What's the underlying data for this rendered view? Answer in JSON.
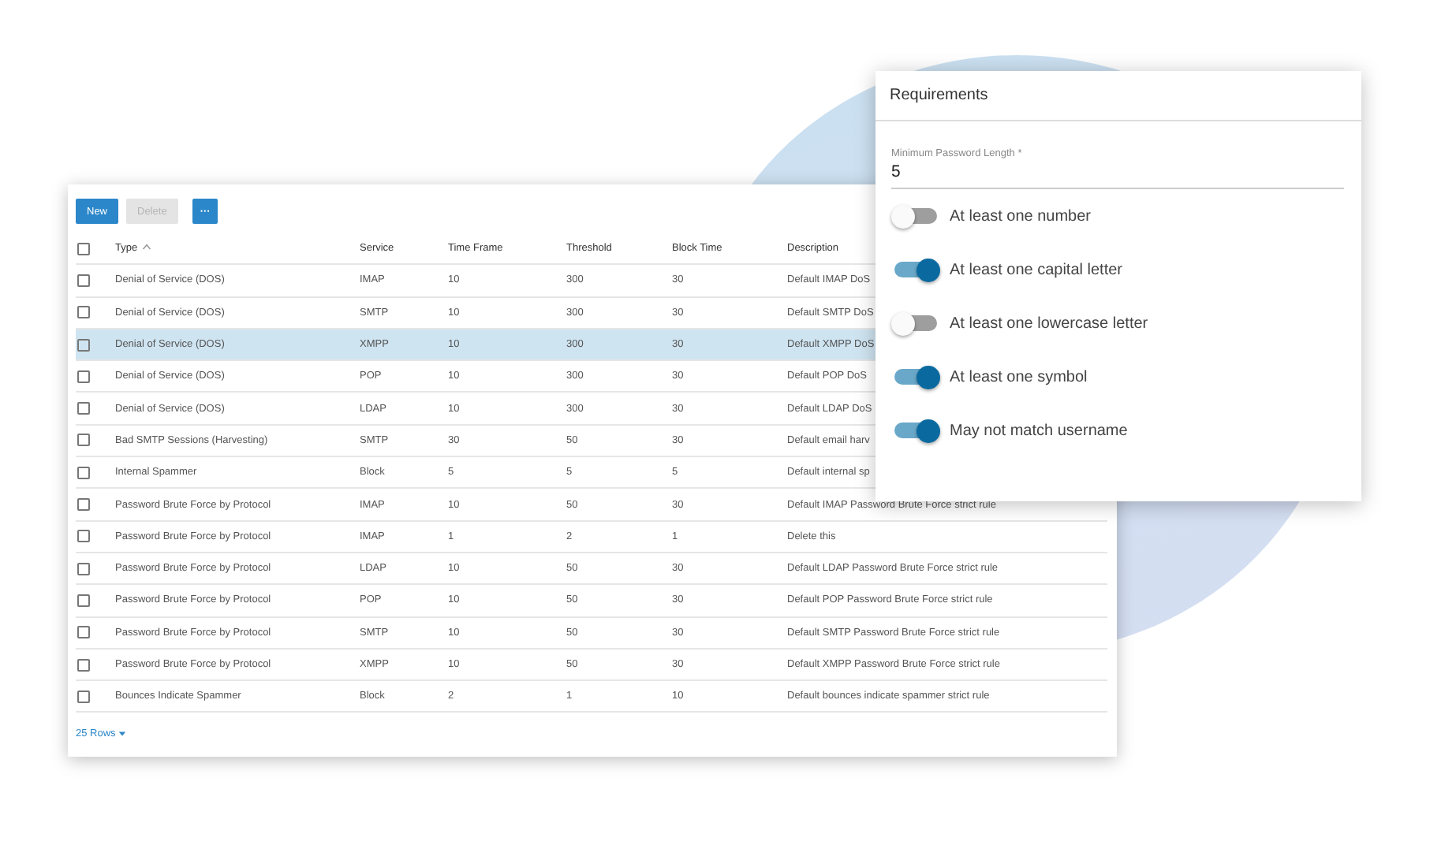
{
  "toolbar": {
    "buttons": [
      {
        "label": "New",
        "kind": "primary",
        "disabled": false
      },
      {
        "label": "Delete",
        "kind": "primary",
        "disabled": true
      },
      {
        "label": "···",
        "kind": "more",
        "disabled": false
      }
    ]
  },
  "table": {
    "select_all": {
      "checked": false
    },
    "columns": [
      {
        "label": "Type",
        "sorted": true
      },
      {
        "label": "Service",
        "sorted": false
      },
      {
        "label": "Time Frame",
        "sorted": false
      },
      {
        "label": "Threshold",
        "sorted": false
      },
      {
        "label": "Block Time",
        "sorted": false
      },
      {
        "label": "Description",
        "sorted": false
      }
    ],
    "rows": [
      {
        "cells": [
          "Denial of Service (DOS)",
          "IMAP",
          "10",
          "300",
          "30",
          "Default IMAP DoS"
        ],
        "checked": false,
        "selected": false
      },
      {
        "cells": [
          "Denial of Service (DOS)",
          "SMTP",
          "10",
          "300",
          "30",
          "Default SMTP DoS"
        ],
        "checked": false,
        "selected": false
      },
      {
        "cells": [
          "Denial of Service (DOS)",
          "XMPP",
          "10",
          "300",
          "30",
          "Default XMPP DoS"
        ],
        "checked": false,
        "selected": true
      },
      {
        "cells": [
          "Denial of Service (DOS)",
          "POP",
          "10",
          "300",
          "30",
          "Default POP DoS"
        ],
        "checked": false,
        "selected": false
      },
      {
        "cells": [
          "Denial of Service (DOS)",
          "LDAP",
          "10",
          "300",
          "30",
          "Default LDAP DoS"
        ],
        "checked": false,
        "selected": false
      },
      {
        "cells": [
          "Bad SMTP Sessions (Harvesting)",
          "SMTP",
          "30",
          "50",
          "30",
          "Default email harv"
        ],
        "checked": false,
        "selected": false
      },
      {
        "cells": [
          "Internal Spammer",
          "Block",
          "5",
          "5",
          "5",
          "Default internal sp"
        ],
        "checked": false,
        "selected": false
      },
      {
        "cells": [
          "Password Brute Force by Protocol",
          "IMAP",
          "10",
          "50",
          "30",
          "Default IMAP Password Brute Force strict rule"
        ],
        "checked": false,
        "selected": false
      },
      {
        "cells": [
          "Password Brute Force by Protocol",
          "IMAP",
          "1",
          "2",
          "1",
          "Delete this"
        ],
        "checked": false,
        "selected": false
      },
      {
        "cells": [
          "Password Brute Force by Protocol",
          "LDAP",
          "10",
          "50",
          "30",
          "Default LDAP Password Brute Force strict rule"
        ],
        "checked": false,
        "selected": false
      },
      {
        "cells": [
          "Password Brute Force by Protocol",
          "POP",
          "10",
          "50",
          "30",
          "Default POP Password Brute Force strict rule"
        ],
        "checked": false,
        "selected": false
      },
      {
        "cells": [
          "Password Brute Force by Protocol",
          "SMTP",
          "10",
          "50",
          "30",
          "Default SMTP Password Brute Force strict rule"
        ],
        "checked": false,
        "selected": false
      },
      {
        "cells": [
          "Password Brute Force by Protocol",
          "XMPP",
          "10",
          "50",
          "30",
          "Default XMPP Password Brute Force strict rule"
        ],
        "checked": false,
        "selected": false
      },
      {
        "cells": [
          "Bounces Indicate Spammer",
          "Block",
          "2",
          "1",
          "10",
          "Default bounces indicate spammer strict rule"
        ],
        "checked": false,
        "selected": false
      }
    ],
    "rows_per_page": "25 Rows"
  },
  "requirements": {
    "title": "Requirements",
    "field": {
      "label": "Minimum Password Length *",
      "value": "5"
    },
    "toggles": [
      {
        "label": "At least one number",
        "on": false
      },
      {
        "label": "At least one capital letter",
        "on": true
      },
      {
        "label": "At least one lowercase letter",
        "on": false
      },
      {
        "label": "At least one symbol",
        "on": true
      },
      {
        "label": "May not match username",
        "on": true
      }
    ]
  }
}
